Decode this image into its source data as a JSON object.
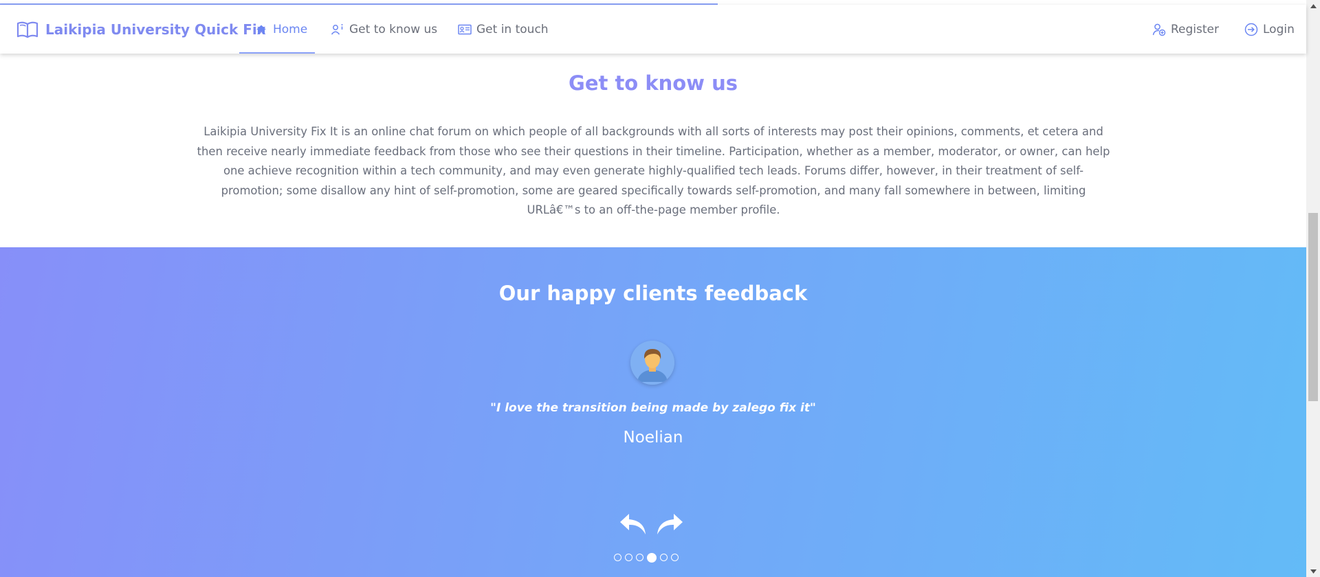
{
  "navbar": {
    "brand": "Laikipia University Quick Fix",
    "items": [
      {
        "label": "Home",
        "icon": "home-icon",
        "active": true
      },
      {
        "label": "Get to know us",
        "icon": "user-info-icon",
        "active": false
      },
      {
        "label": "Get in touch",
        "icon": "contact-card-icon",
        "active": false
      }
    ],
    "register_label": "Register",
    "login_label": "Login"
  },
  "about": {
    "title": "Get to know us",
    "text": "Laikipia University Fix It is an online chat forum on which people of all backgrounds with all sorts of interests may post their opinions, comments, et cetera and then receive nearly immediate feedback from those who see their questions in their timeline. Participation, whether as a member, moderator, or owner, can help one achieve recognition within a tech community, and may even generate highly-qualified tech leads. Forums differ, however, in their treatment of self-promotion; some disallow any hint of self-promotion, some are geared specifically towards self-promotion, and many fall somewhere in between, limiting URLâ€™s to an off-the-page member profile."
  },
  "feedback": {
    "title": "Our happy clients feedback",
    "quote": "\"I love the transition being made by zalego fix it\"",
    "name": "Noelian",
    "slide_count": 6,
    "active_slide": 4
  },
  "colors": {
    "accent": "#7f8af0",
    "gradient_start": "#878ff9",
    "gradient_end": "#63bbf7"
  }
}
